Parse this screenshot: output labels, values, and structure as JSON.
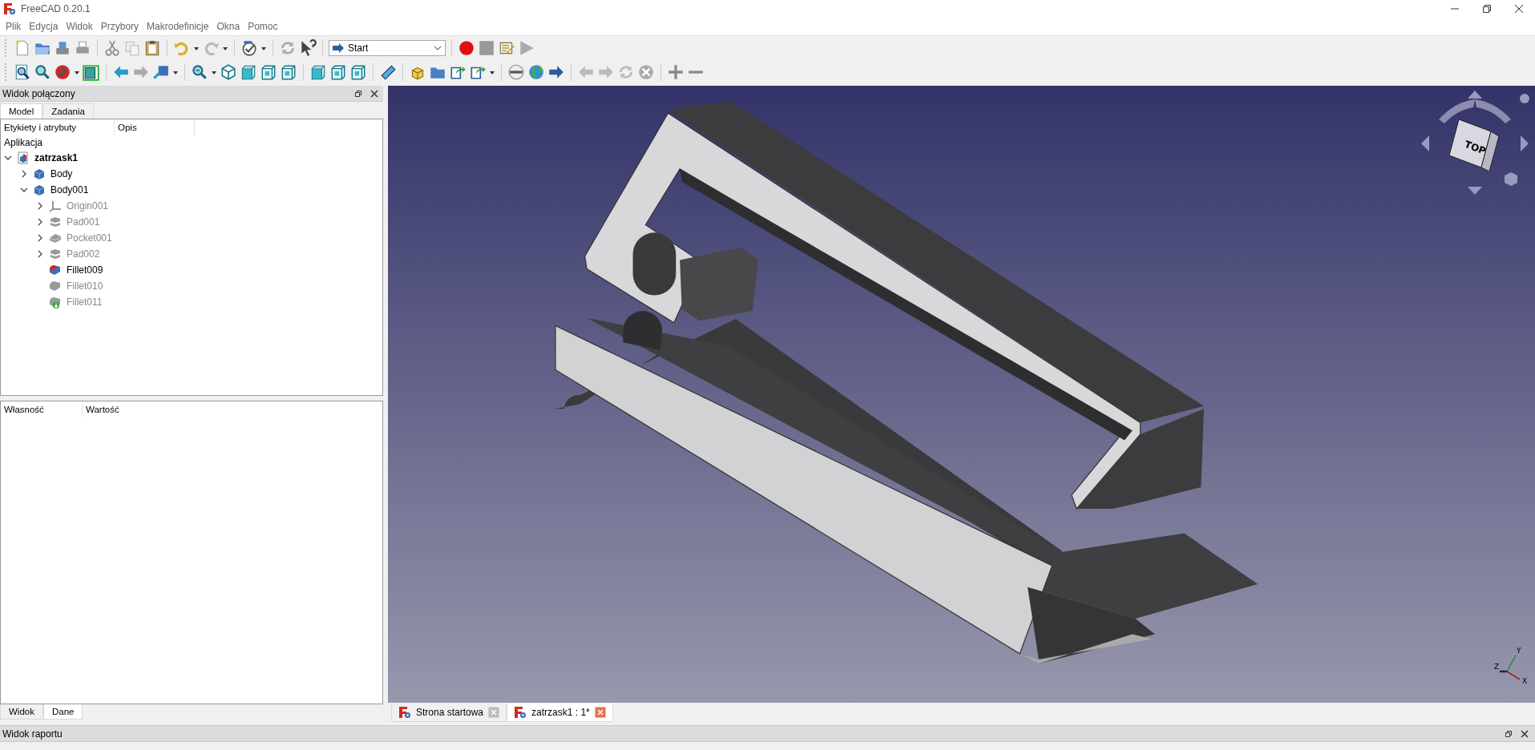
{
  "window": {
    "title": "FreeCAD 0.20.1"
  },
  "menu": [
    "Plik",
    "Edycja",
    "Widok",
    "Przybory",
    "Makrodefinicje",
    "Okna",
    "Pomoc"
  ],
  "workbench": {
    "value": "Start"
  },
  "combo_view": {
    "title": "Widok połączony",
    "tabs": [
      {
        "label": "Model",
        "selected": true
      },
      {
        "label": "Zadania",
        "selected": false
      }
    ],
    "tree": {
      "columns": [
        "Etykiety i atrybuty",
        "Opis"
      ],
      "root_label": "Aplikacja",
      "items": [
        {
          "label": "zatrzask1",
          "kind": "document",
          "expanded": true,
          "visible": true,
          "children": [
            {
              "label": "Body",
              "kind": "body",
              "expanded": false,
              "visible": true
            },
            {
              "label": "Body001",
              "kind": "body",
              "expanded": true,
              "visible": true,
              "children": [
                {
                  "label": "Origin001",
                  "kind": "origin",
                  "expanded": false,
                  "visible": false
                },
                {
                  "label": "Pad001",
                  "kind": "pad",
                  "expanded": false,
                  "visible": false
                },
                {
                  "label": "Pocket001",
                  "kind": "pocket",
                  "expanded": false,
                  "visible": false
                },
                {
                  "label": "Pad002",
                  "kind": "pad",
                  "expanded": false,
                  "visible": false
                },
                {
                  "label": "Fillet009",
                  "kind": "fillet_tip",
                  "visible": true
                },
                {
                  "label": "Fillet010",
                  "kind": "fillet",
                  "visible": false
                },
                {
                  "label": "Fillet011",
                  "kind": "fillet_new",
                  "visible": false
                }
              ]
            }
          ]
        }
      ]
    },
    "properties": {
      "columns": [
        "Własność",
        "Wartość"
      ]
    },
    "bottom_tabs": [
      {
        "label": "Widok",
        "selected": false
      },
      {
        "label": "Dane",
        "selected": true
      }
    ]
  },
  "viewport": {
    "nav_cube_face": "TOP",
    "axis_labels": [
      "Y",
      "Z",
      "X"
    ]
  },
  "document_tabs": [
    {
      "label": "Strona startowa",
      "selected": false
    },
    {
      "label": "zatrzask1 : 1*",
      "selected": true
    }
  ],
  "report_view": {
    "title": "Widok raportu"
  }
}
